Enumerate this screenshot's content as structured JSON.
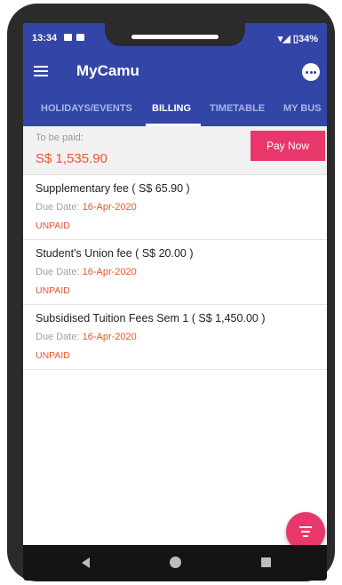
{
  "status_bar": {
    "time": "13:34",
    "battery": "34%"
  },
  "app_bar": {
    "title": "MyCamu"
  },
  "tabs": [
    {
      "label": "HOLIDAYS/EVENTS"
    },
    {
      "label": "BILLING"
    },
    {
      "label": "TIMETABLE"
    },
    {
      "label": "MY BUS"
    }
  ],
  "summary": {
    "label": "To be paid:",
    "amount": "S$ 1,535.90",
    "pay_button": "Pay Now"
  },
  "fees": [
    {
      "title": "Supplementary fee ( S$ 65.90 )",
      "due_label": "Due Date:",
      "due_date": "16-Apr-2020",
      "status": "UNPAID"
    },
    {
      "title": "Student's Union fee ( S$ 20.00 )",
      "due_label": "Due Date:",
      "due_date": "16-Apr-2020",
      "status": "UNPAID"
    },
    {
      "title": "Subsidised Tuition Fees Sem 1 ( S$ 1,450.00 )",
      "due_label": "Due Date:",
      "due_date": "16-Apr-2020",
      "status": "UNPAID"
    }
  ],
  "colors": {
    "primary": "#3346a8",
    "accent": "#e8386b",
    "amount": "#e8562c"
  },
  "icons": {
    "menu": "menu-icon",
    "chat": "chat-icon",
    "filter": "filter-icon"
  }
}
